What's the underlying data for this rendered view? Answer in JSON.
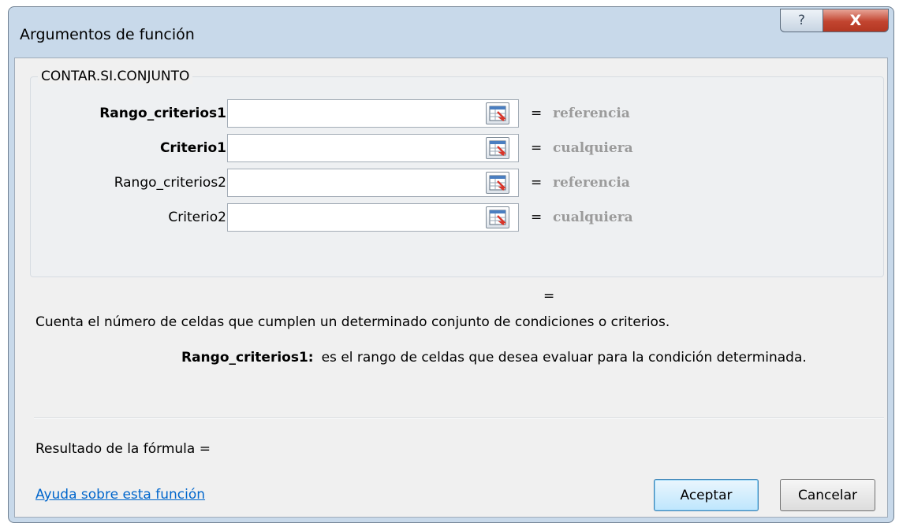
{
  "window": {
    "title": "Argumentos de función",
    "help_button": "?",
    "close_button": "X"
  },
  "function_group": {
    "name": "CONTAR.SI.CONJUNTO",
    "arguments": [
      {
        "label": "Rango_criterios1",
        "bold": true,
        "value": "",
        "result_sign": "=",
        "result_type": "referencia"
      },
      {
        "label": "Criterio1",
        "bold": true,
        "value": "",
        "result_sign": "=",
        "result_type": "cualquiera"
      },
      {
        "label": "Rango_criterios2",
        "bold": false,
        "value": "",
        "result_sign": "=",
        "result_type": "referencia"
      },
      {
        "label": "Criterio2",
        "bold": false,
        "value": "",
        "result_sign": "=",
        "result_type": "cualquiera"
      }
    ],
    "collapse_icon": "range-selector-icon"
  },
  "result_sign": "=",
  "description": "Cuenta el número de celdas que cumplen un determinado conjunto de condiciones o criterios.",
  "argument_help": {
    "name": "Rango_criterios1:",
    "text": "es el rango de celdas que desea evaluar para la condición determinada."
  },
  "formula_result_label": "Resultado de la fórmula =",
  "help_link": "Ayuda sobre esta función",
  "buttons": {
    "ok": "Aceptar",
    "cancel": "Cancelar"
  },
  "colors": {
    "link": "#0066cc",
    "result_type_text": "#9b9b9b",
    "close_button": "#c2442f",
    "frame": "#c8d9ea"
  }
}
